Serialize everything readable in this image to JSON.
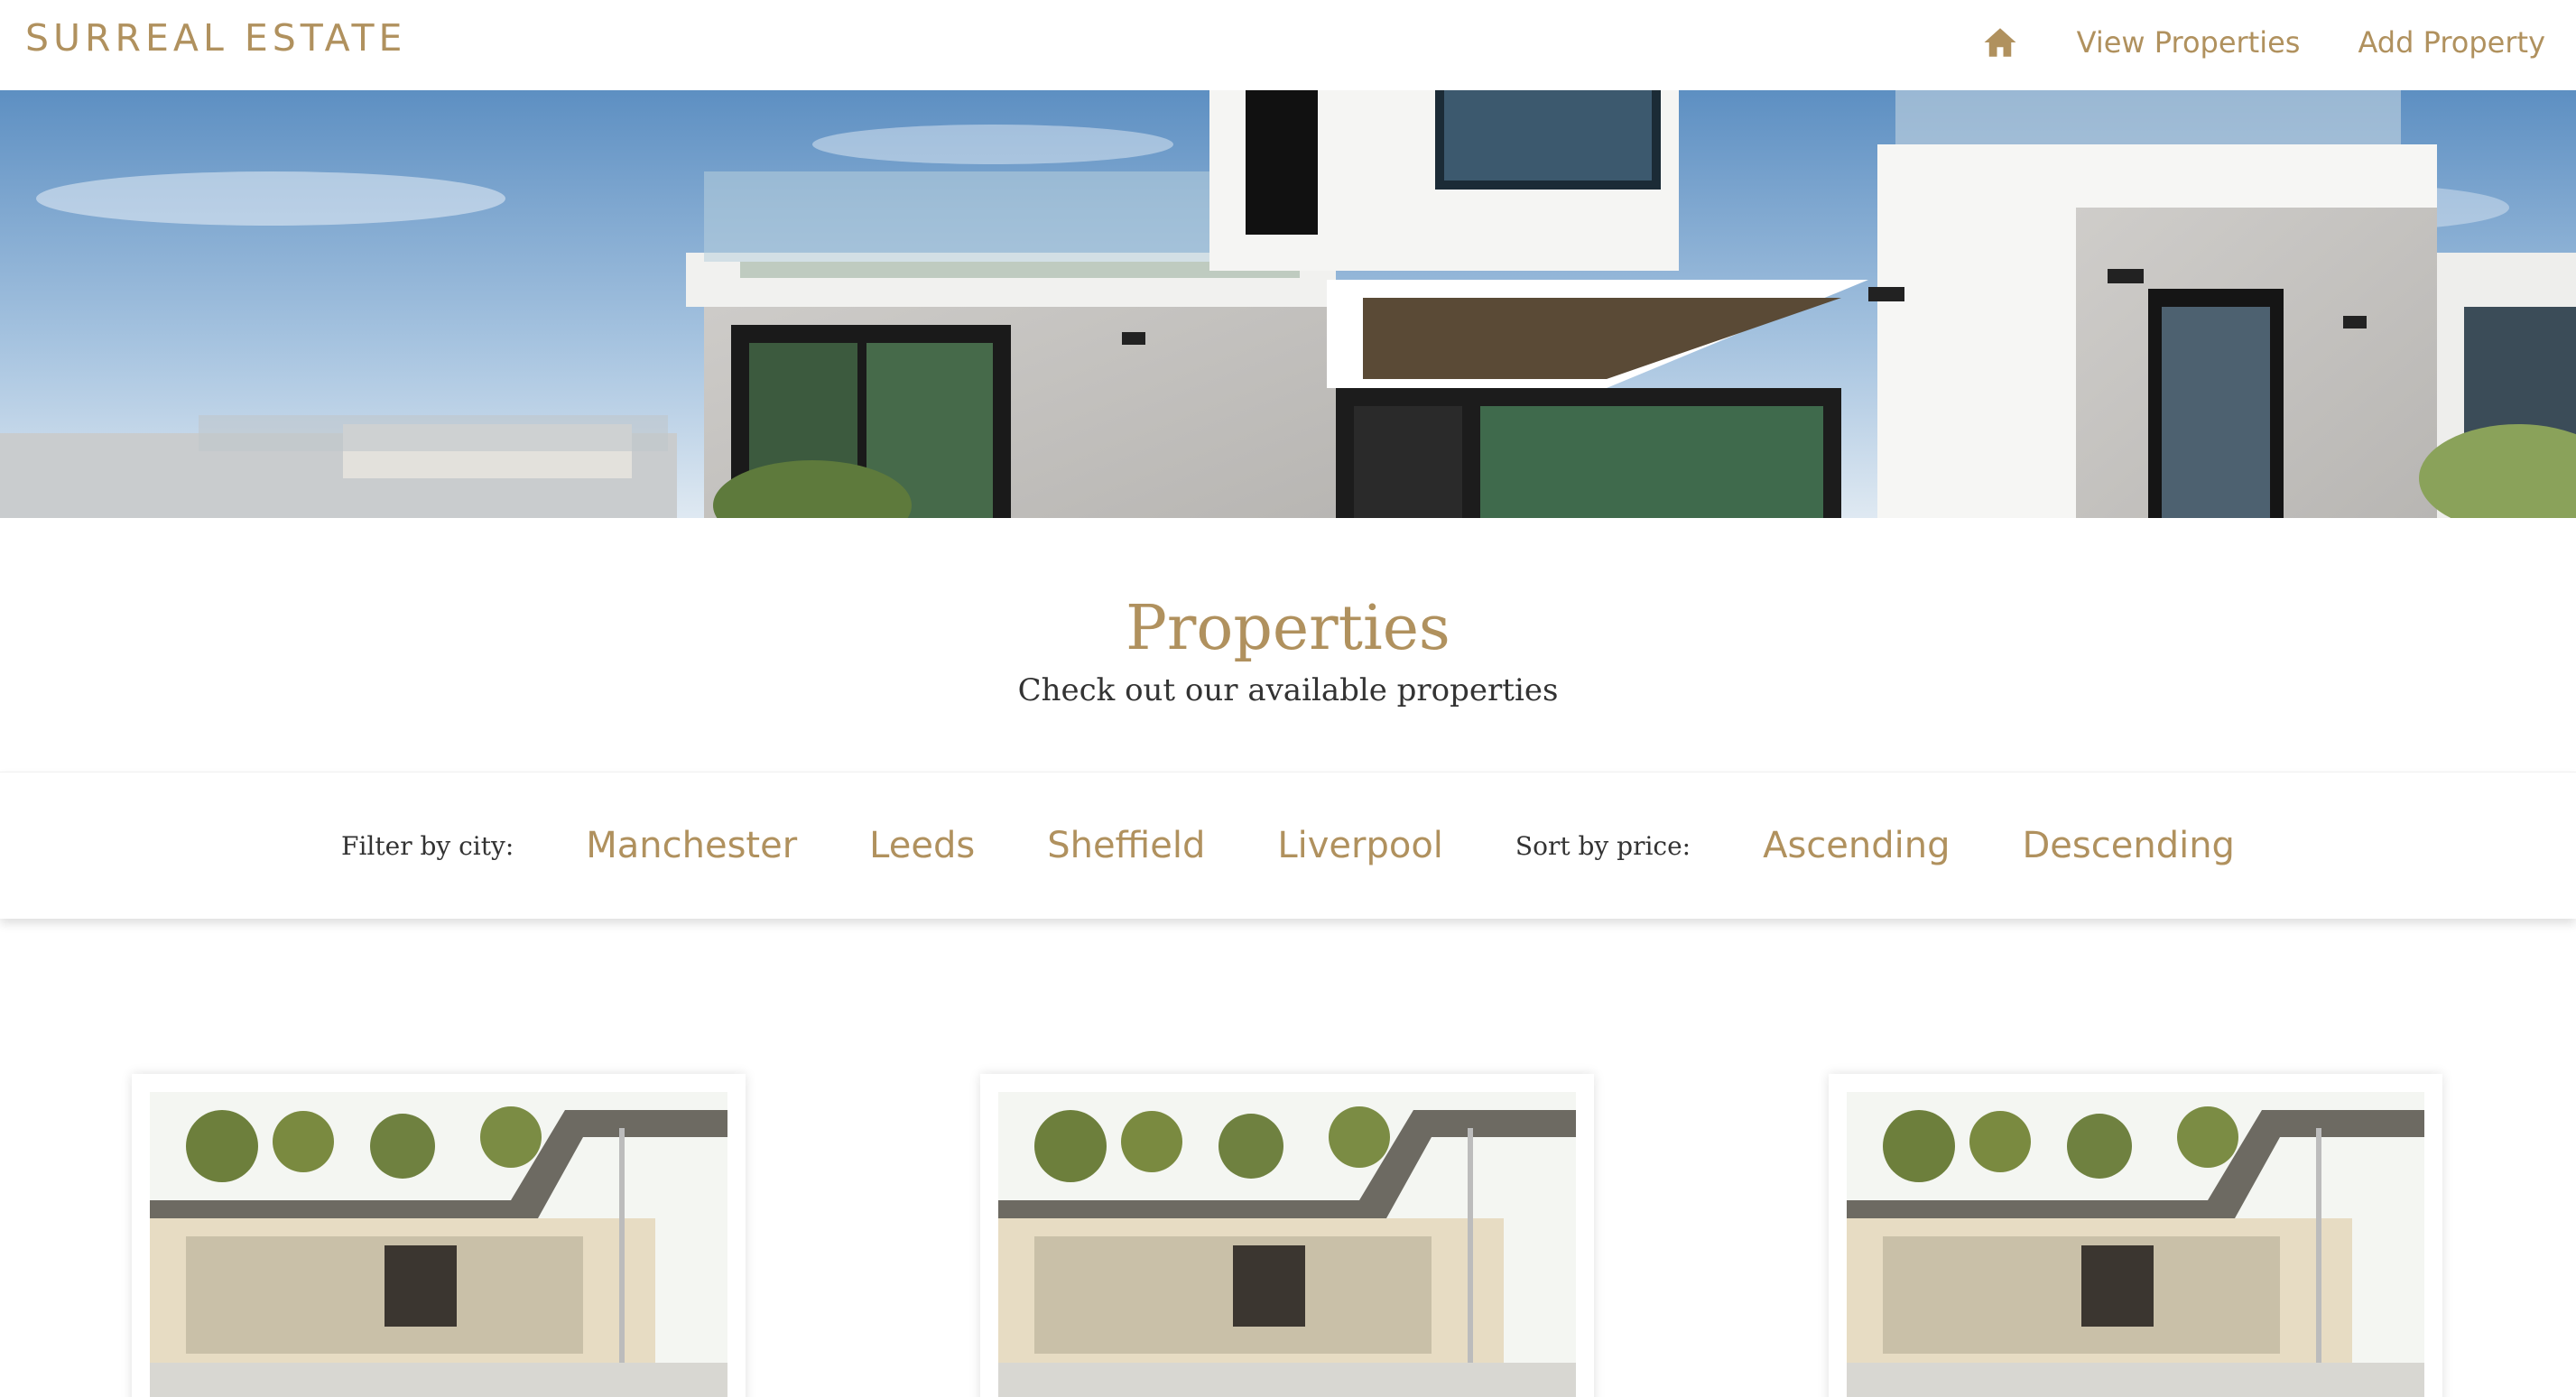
{
  "brand": "SURREAL ESTATE",
  "nav": {
    "home_icon": "home-icon",
    "view_properties": "View Properties",
    "add_property": "Add Property"
  },
  "heading": {
    "title": "Properties",
    "subtitle": "Check out our available properties"
  },
  "filters": {
    "city_label": "Filter by city:",
    "cities": [
      "Manchester",
      "Leeds",
      "Sheffield",
      "Liverpool"
    ],
    "sort_label": "Sort by price:",
    "sort_options": [
      "Ascending",
      "Descending"
    ]
  },
  "colors": {
    "accent": "#b0915e",
    "text": "#333333"
  },
  "cards": [
    {
      "image": "house-photo"
    },
    {
      "image": "house-photo"
    },
    {
      "image": "house-photo"
    }
  ]
}
